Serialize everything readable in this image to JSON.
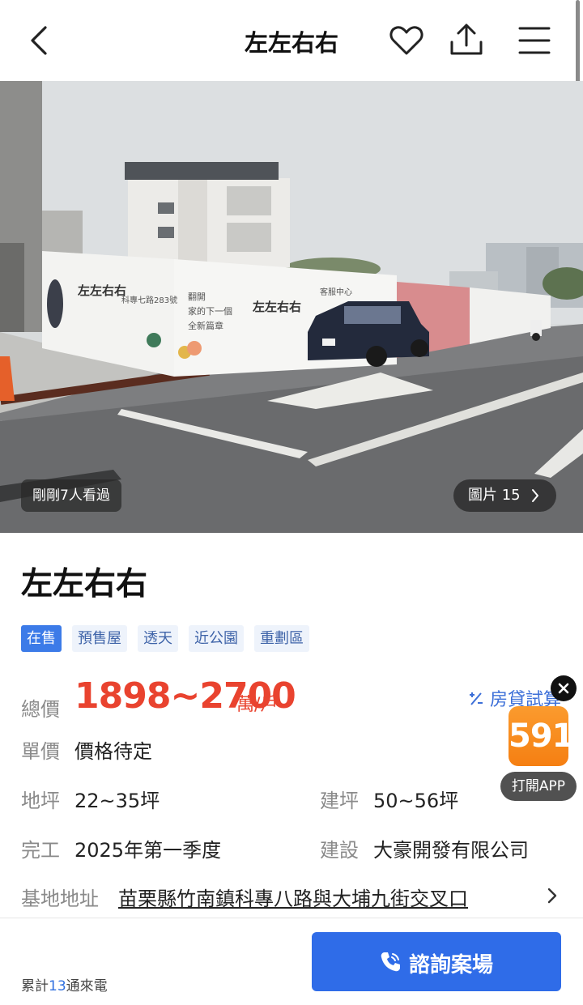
{
  "header": {
    "title": "左左右右"
  },
  "gallery": {
    "views_text": "剛剛7人看過",
    "photo_count_label": "圖片 15",
    "hoarding_text": {
      "brand": "左左右右",
      "address_sign": "科專七路283號",
      "slogan_line1": "翻開",
      "slogan_line2": "家的下一個",
      "slogan_line3": "全新篇章",
      "sales_center": "客服中心"
    }
  },
  "project": {
    "title": "左左右右",
    "tags": [
      "在售",
      "預售屋",
      "透天",
      "近公園",
      "重劃區"
    ],
    "price": {
      "label": "總價",
      "value": "1898~2700",
      "unit": "萬/戶"
    },
    "loan_calc_label": "房貸試算",
    "unit_price": {
      "label": "單價",
      "value": "價格待定"
    },
    "land_area": {
      "label": "地坪",
      "value": "22~35坪"
    },
    "building_area": {
      "label": "建坪",
      "value": "50~56坪"
    },
    "completion": {
      "label": "完工",
      "value": "2025年第一季度"
    },
    "developer": {
      "label": "建設",
      "value": "大豪開發有限公司"
    },
    "address": {
      "label": "基地地址",
      "value": "苗栗縣竹南鎮科專八路與大埔九街交叉口"
    }
  },
  "app_promo": {
    "logo_text": "591",
    "open_label": "打開APP",
    "logo_color": "#f5861a"
  },
  "footer": {
    "calls_prefix": "累計",
    "calls_count": "13",
    "calls_suffix": "通來電",
    "consult_label": "諮詢案場",
    "button_color": "#2f6ce8"
  }
}
